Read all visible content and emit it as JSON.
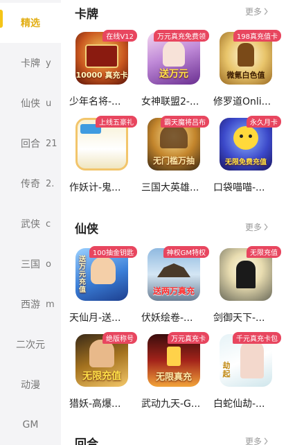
{
  "sidebar": {
    "items": [
      {
        "label": "精选",
        "letter": "",
        "active": true
      },
      {
        "label": "卡牌",
        "letter": "y",
        "active": false
      },
      {
        "label": "仙侠",
        "letter": "u",
        "active": false
      },
      {
        "label": "回合",
        "letter": "21",
        "active": false
      },
      {
        "label": "传奇",
        "letter": "2.",
        "active": false
      },
      {
        "label": "武侠",
        "letter": "c",
        "active": false
      },
      {
        "label": "三国",
        "letter": "o",
        "active": false
      },
      {
        "label": "西游",
        "letter": "m",
        "active": false
      },
      {
        "label": "二次元",
        "letter": "",
        "active": false
      },
      {
        "label": "动漫",
        "letter": "",
        "active": false
      },
      {
        "label": "GM",
        "letter": "",
        "active": false
      }
    ]
  },
  "sections": [
    {
      "title": "卡牌",
      "more": "更多",
      "games": [
        {
          "name": "少年名将-...",
          "badge": "在线V12",
          "art": "10000 真充卡"
        },
        {
          "name": "女神联盟2-...",
          "badge": "万元真充免费领",
          "art": "送万元"
        },
        {
          "name": "修罗道Onli...",
          "badge": "198真充值卡",
          "art": "微氪白色值"
        },
        {
          "name": "作妖计-鬼...",
          "badge": "上线五豪礼",
          "art": ""
        },
        {
          "name": "三国大英雄...",
          "badge": "霸天魔将吕布",
          "art": "无门槛万抽"
        },
        {
          "name": "口袋喵喵-...",
          "badge": "永久月卡",
          "art": "无限免费充值"
        }
      ]
    },
    {
      "title": "仙侠",
      "more": "更多",
      "games": [
        {
          "name": "天仙月-送...",
          "badge": "100抽金钥匙",
          "art": "送万元充值"
        },
        {
          "name": "伏妖绘卷-...",
          "badge": "神权GM特权",
          "art": "送两万真充"
        },
        {
          "name": "剑御天下-...",
          "badge": "无限充值",
          "art": ""
        },
        {
          "name": "猎妖-高爆...",
          "badge": "绝版称号",
          "art": "无限充值"
        },
        {
          "name": "武动九天-G...",
          "badge": "万元真充卡",
          "art": "无限真充"
        },
        {
          "name": "白蛇仙劫-...",
          "badge": "千元真充卡包",
          "art": "劫起"
        }
      ]
    },
    {
      "title": "回合",
      "more": "更多",
      "games": []
    }
  ],
  "colors": {
    "accent": "#f5c518",
    "accent_text": "#e2ae15",
    "badge": "#e8465f",
    "sidebar_bg": "#f4f4f6"
  }
}
